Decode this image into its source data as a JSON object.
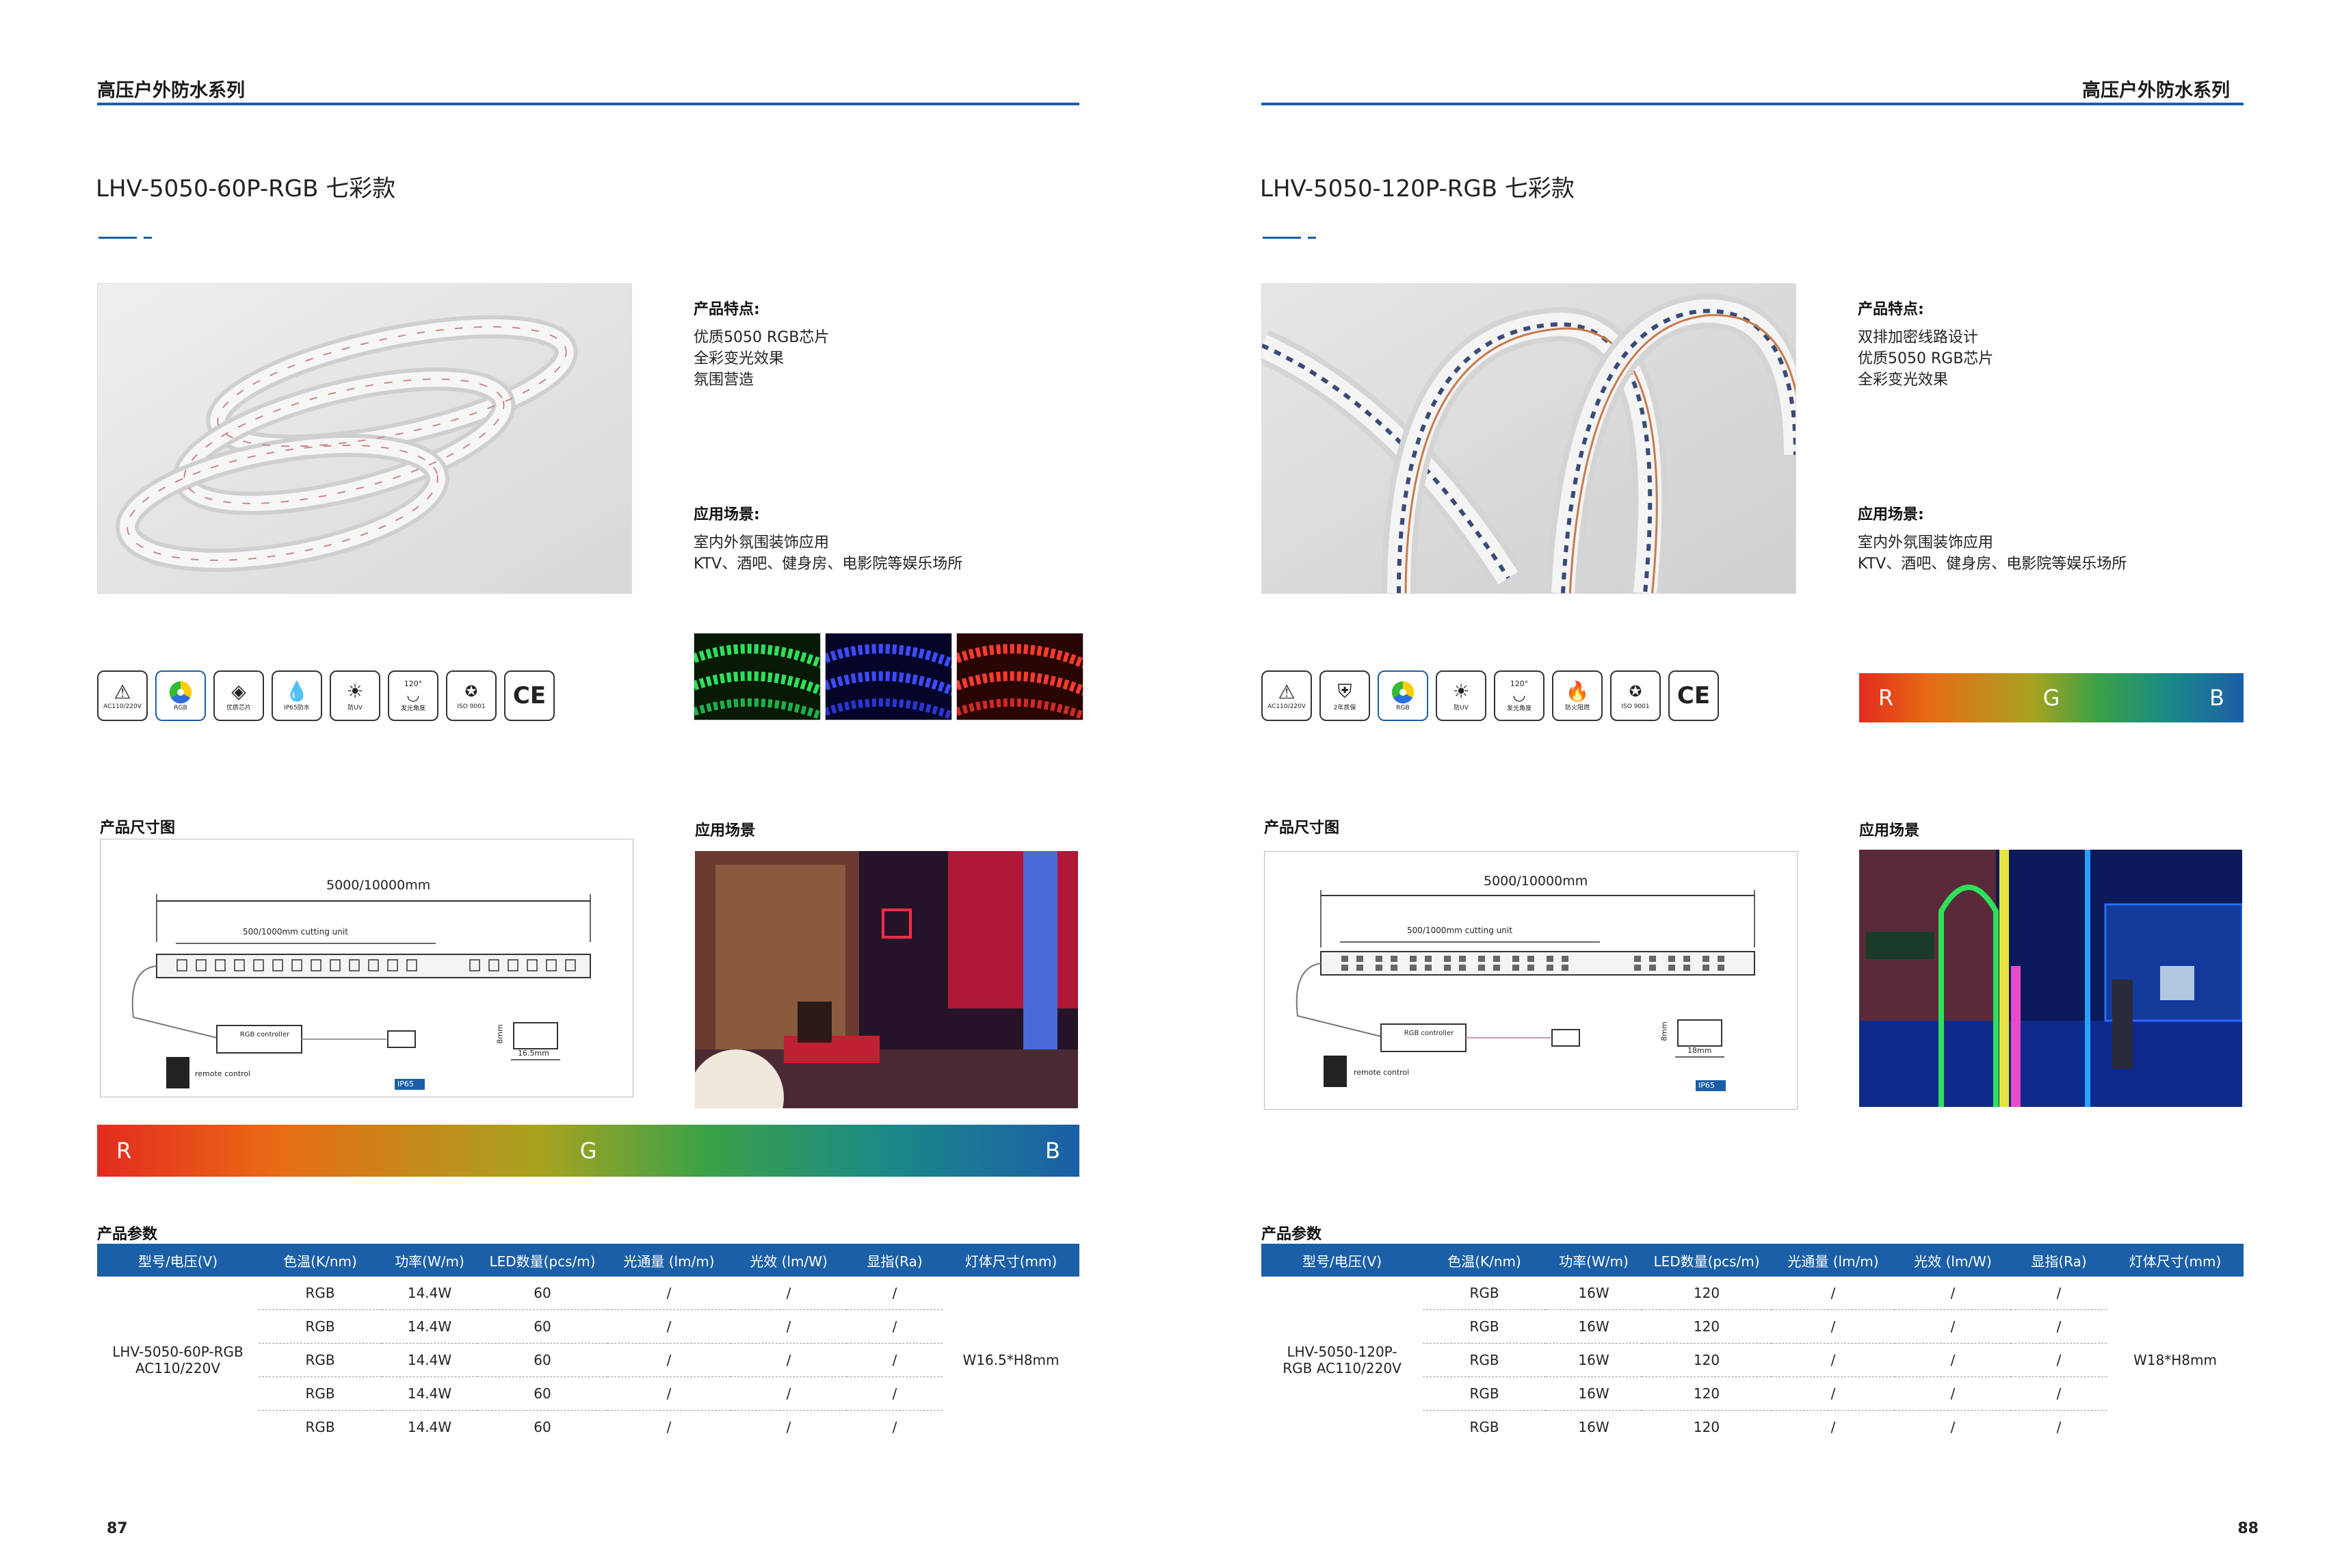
{
  "pages": [
    {
      "series": "高压户外防水系列",
      "model_title": "LHV-5050-60P-RGB 七彩款",
      "features": {
        "title": "产品特点:",
        "lines": [
          "优质5050 RGB芯片",
          "全彩变光效果",
          "氛围营造"
        ]
      },
      "applications": {
        "title": "应用场景:",
        "lines": [
          "室内外氛围装饰应用",
          "KTV、酒吧、健身房、电影院等娱乐场所"
        ]
      },
      "icons": [
        {
          "icon": "warning-voltage-icon",
          "label": "AC110/220V"
        },
        {
          "icon": "rgb-color-wheel-icon",
          "label": "RGB"
        },
        {
          "icon": "chip-icon",
          "label": "优质芯片"
        },
        {
          "icon": "water-drop-icon",
          "label": "IP65防水"
        },
        {
          "icon": "uv-icon",
          "label": "防UV"
        },
        {
          "icon": "beam-angle-icon",
          "label": "发光角度",
          "value": "120°"
        },
        {
          "icon": "iso-icon",
          "label": "ISO 9001"
        },
        {
          "icon": "ce-mark-icon",
          "label": "CE"
        }
      ],
      "dimension_title": "产品尺寸图",
      "scene_title": "应用场景",
      "dimension": {
        "total": "5000/10000mm",
        "cut": "500/1000mm cutting unit",
        "controller": "RGB controller",
        "remote": "remote control",
        "height": "8mm",
        "width": "16.5mm",
        "ip": "IP65"
      },
      "gradient": {
        "r": "R",
        "g": "G",
        "b": "B"
      },
      "params_title": "产品参数",
      "table": {
        "headers": [
          "型号/电压(V)",
          "色温(K/nm)",
          "功率(W/m)",
          "LED数量(pcs/m)",
          "光通量 (lm/m)",
          "光效 (lm/W)",
          "显指(Ra)",
          "灯体尺寸(mm)"
        ],
        "model": "LHV-5050-60P-RGB AC110/220V",
        "size": "W16.5*H8mm",
        "rows": [
          [
            "RGB",
            "14.4W",
            "60",
            "/",
            "/",
            "/"
          ],
          [
            "RGB",
            "14.4W",
            "60",
            "/",
            "/",
            "/"
          ],
          [
            "RGB",
            "14.4W",
            "60",
            "/",
            "/",
            "/"
          ],
          [
            "RGB",
            "14.4W",
            "60",
            "/",
            "/",
            "/"
          ],
          [
            "RGB",
            "14.4W",
            "60",
            "/",
            "/",
            "/"
          ]
        ]
      },
      "page_number": "87"
    },
    {
      "series": "高压户外防水系列",
      "model_title": "LHV-5050-120P-RGB 七彩款",
      "features": {
        "title": "产品特点:",
        "lines": [
          "双排加密线路设计",
          "优质5050 RGB芯片",
          "全彩变光效果"
        ]
      },
      "applications": {
        "title": "应用场景:",
        "lines": [
          "室内外氛围装饰应用",
          "KTV、酒吧、健身房、电影院等娱乐场所"
        ]
      },
      "icons": [
        {
          "icon": "warning-voltage-icon",
          "label": "AC110/220V"
        },
        {
          "icon": "shield-icon",
          "label": "2年质保"
        },
        {
          "icon": "rgb-color-wheel-icon",
          "label": "RGB"
        },
        {
          "icon": "uv-icon",
          "label": "防UV"
        },
        {
          "icon": "beam-angle-icon",
          "label": "发光角度",
          "value": "120°"
        },
        {
          "icon": "flame-icon",
          "label": "防火阻燃"
        },
        {
          "icon": "iso-icon",
          "label": "ISO 9001"
        },
        {
          "icon": "ce-mark-icon",
          "label": "CE"
        }
      ],
      "dimension_title": "产品尺寸图",
      "scene_title": "应用场景",
      "dimension": {
        "total": "5000/10000mm",
        "cut": "500/1000mm cutting unit",
        "controller": "RGB controller",
        "remote": "remote control",
        "height": "8mm",
        "width": "18mm",
        "ip": "IP65"
      },
      "gradient": {
        "r": "R",
        "g": "G",
        "b": "B"
      },
      "params_title": "产品参数",
      "table": {
        "headers": [
          "型号/电压(V)",
          "色温(K/nm)",
          "功率(W/m)",
          "LED数量(pcs/m)",
          "光通量 (lm/m)",
          "光效 (lm/W)",
          "显指(Ra)",
          "灯体尺寸(mm)"
        ],
        "model": "LHV-5050-120P-RGB AC110/220V",
        "size": "W18*H8mm",
        "rows": [
          [
            "RGB",
            "16W",
            "120",
            "/",
            "/",
            "/"
          ],
          [
            "RGB",
            "16W",
            "120",
            "/",
            "/",
            "/"
          ],
          [
            "RGB",
            "16W",
            "120",
            "/",
            "/",
            "/"
          ],
          [
            "RGB",
            "16W",
            "120",
            "/",
            "/",
            "/"
          ],
          [
            "RGB",
            "16W",
            "120",
            "/",
            "/",
            "/"
          ]
        ]
      },
      "page_number": "88"
    }
  ],
  "colors": {
    "brand_blue": "#1b5fa7",
    "red": "#e32b1e",
    "green": "#3ba146",
    "blue": "#1b5fa7"
  }
}
